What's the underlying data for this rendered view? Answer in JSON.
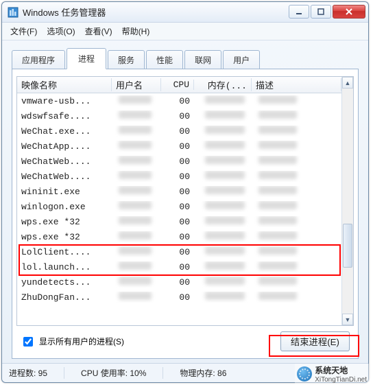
{
  "window": {
    "title": "Windows 任务管理器"
  },
  "menu": {
    "file": "文件(F)",
    "options": "选项(O)",
    "view": "查看(V)",
    "help": "帮助(H)"
  },
  "tabs": {
    "applications": "应用程序",
    "processes": "进程",
    "services": "服务",
    "performance": "性能",
    "networking": "联网",
    "users": "用户"
  },
  "columns": {
    "image_name": "映像名称",
    "user_name": "用户名",
    "cpu": "CPU",
    "memory": "内存(...",
    "description": "描述"
  },
  "rows": [
    {
      "name": "vmware-usb...",
      "cpu": "00"
    },
    {
      "name": "wdswfsafe....",
      "cpu": "00"
    },
    {
      "name": "WeChat.exe...",
      "cpu": "00"
    },
    {
      "name": "WeChatApp....",
      "cpu": "00"
    },
    {
      "name": "WeChatWeb....",
      "cpu": "00"
    },
    {
      "name": "WeChatWeb....",
      "cpu": "00"
    },
    {
      "name": "wininit.exe",
      "cpu": "00"
    },
    {
      "name": "winlogon.exe",
      "cpu": "00"
    },
    {
      "name": "wps.exe *32",
      "cpu": "00"
    },
    {
      "name": "wps.exe *32",
      "cpu": "00"
    },
    {
      "name": "LolClient....",
      "cpu": "00",
      "hl": true
    },
    {
      "name": "lol.launch...",
      "cpu": "00",
      "hl": true
    },
    {
      "name": "yundetects...",
      "cpu": "00"
    },
    {
      "name": "ZhuDongFan...",
      "cpu": "00"
    }
  ],
  "controls": {
    "show_all_users": "显示所有用户的进程(S)",
    "end_process": "结束进程(E)"
  },
  "status": {
    "processes": "进程数: 95",
    "cpu_usage": "CPU 使用率: 10%",
    "phys_mem": "物理内存: 86"
  },
  "watermark": {
    "brand": "系统天地",
    "url": "XiTongTianDi.net"
  }
}
